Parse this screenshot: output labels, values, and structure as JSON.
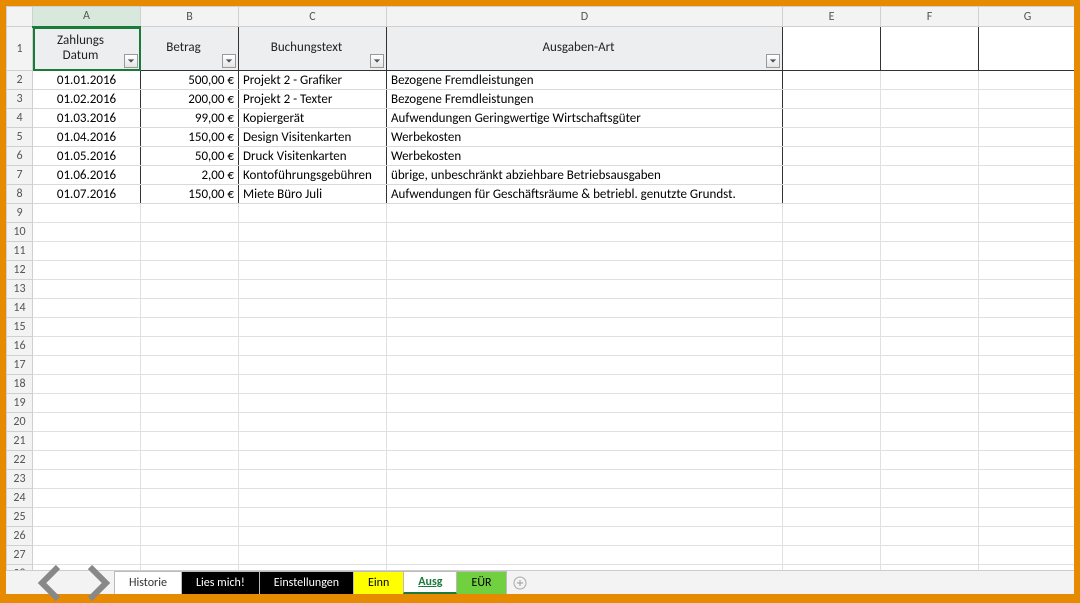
{
  "columns": [
    "A",
    "B",
    "C",
    "D",
    "E",
    "F",
    "G"
  ],
  "selected_column": "A",
  "row_count": 28,
  "headers": {
    "A": "Zahlungs Datum",
    "B": "Betrag",
    "C": "Buchungstext",
    "D": "Ausgaben-Art"
  },
  "rows": [
    {
      "date": "01.01.2016",
      "amount": "500,00 €",
      "text": "Projekt 2 - Grafiker",
      "type": "Bezogene Fremdleistungen"
    },
    {
      "date": "01.02.2016",
      "amount": "200,00 €",
      "text": "Projekt 2 - Texter",
      "type": "Bezogene Fremdleistungen"
    },
    {
      "date": "01.03.2016",
      "amount": "99,00 €",
      "text": "Kopiergerät",
      "type": "Aufwendungen Geringwertige Wirtschaftsgüter"
    },
    {
      "date": "01.04.2016",
      "amount": "150,00 €",
      "text": "Design Visitenkarten",
      "type": "Werbekosten"
    },
    {
      "date": "01.05.2016",
      "amount": "50,00 €",
      "text": "Druck Visitenkarten",
      "type": "Werbekosten"
    },
    {
      "date": "01.06.2016",
      "amount": "2,00 €",
      "text": "Kontoführungsgebühren",
      "type": "übrige, unbeschränkt abziehbare Betriebsausgaben"
    },
    {
      "date": "01.07.2016",
      "amount": "150,00 €",
      "text": "Miete Büro Juli",
      "type": "Aufwendungen für Geschäftsräume & betriebl. genutzte Grundst."
    }
  ],
  "tabs": [
    {
      "label": "Historie",
      "style": "plain"
    },
    {
      "label": "Lies mich!",
      "style": "black"
    },
    {
      "label": "Einstellungen",
      "style": "black"
    },
    {
      "label": "Einn",
      "style": "yellow"
    },
    {
      "label": "Ausg",
      "style": "active"
    },
    {
      "label": "EÜR",
      "style": "greenbg"
    }
  ]
}
